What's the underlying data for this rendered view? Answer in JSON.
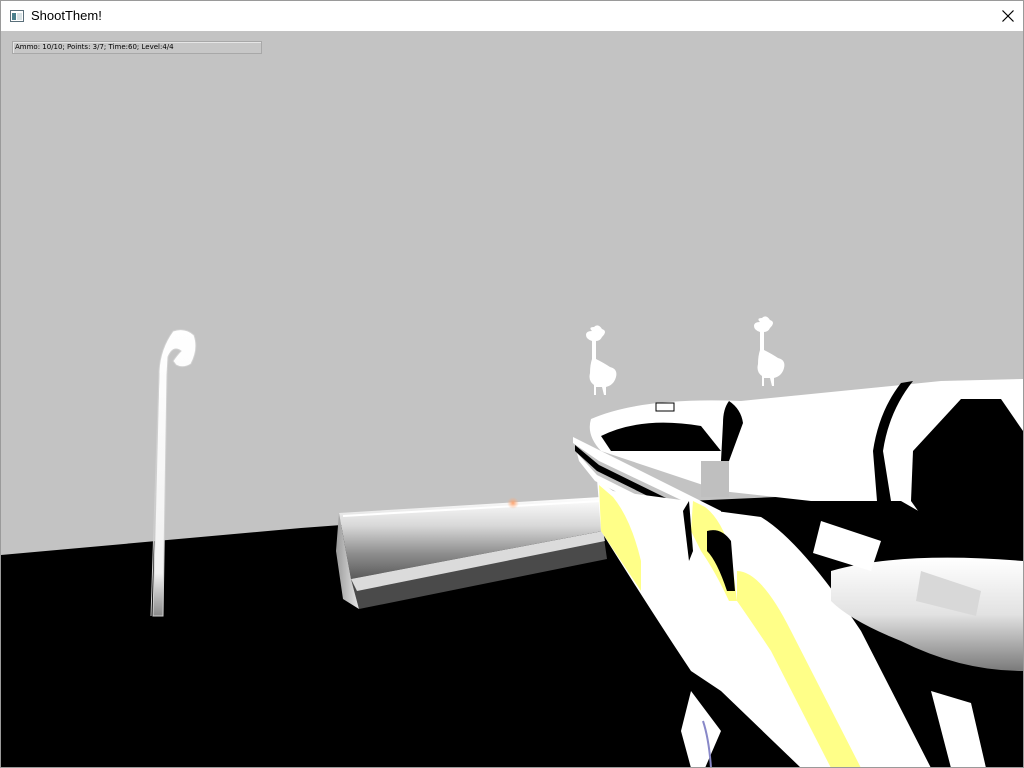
{
  "window": {
    "title": "ShootThem!",
    "icon": "app-window-icon",
    "close_icon": "close-icon"
  },
  "hud": {
    "status_text": "Ammo: 10/10; Points: 3/7; Time:60; Level:4/4"
  },
  "scene": {
    "sky_color": "#c3c3c3",
    "ground_color": "#000000",
    "weapon_accent_color": "#ffff88",
    "weapon_body_color": "#ffffff",
    "targets_visible": 2
  }
}
